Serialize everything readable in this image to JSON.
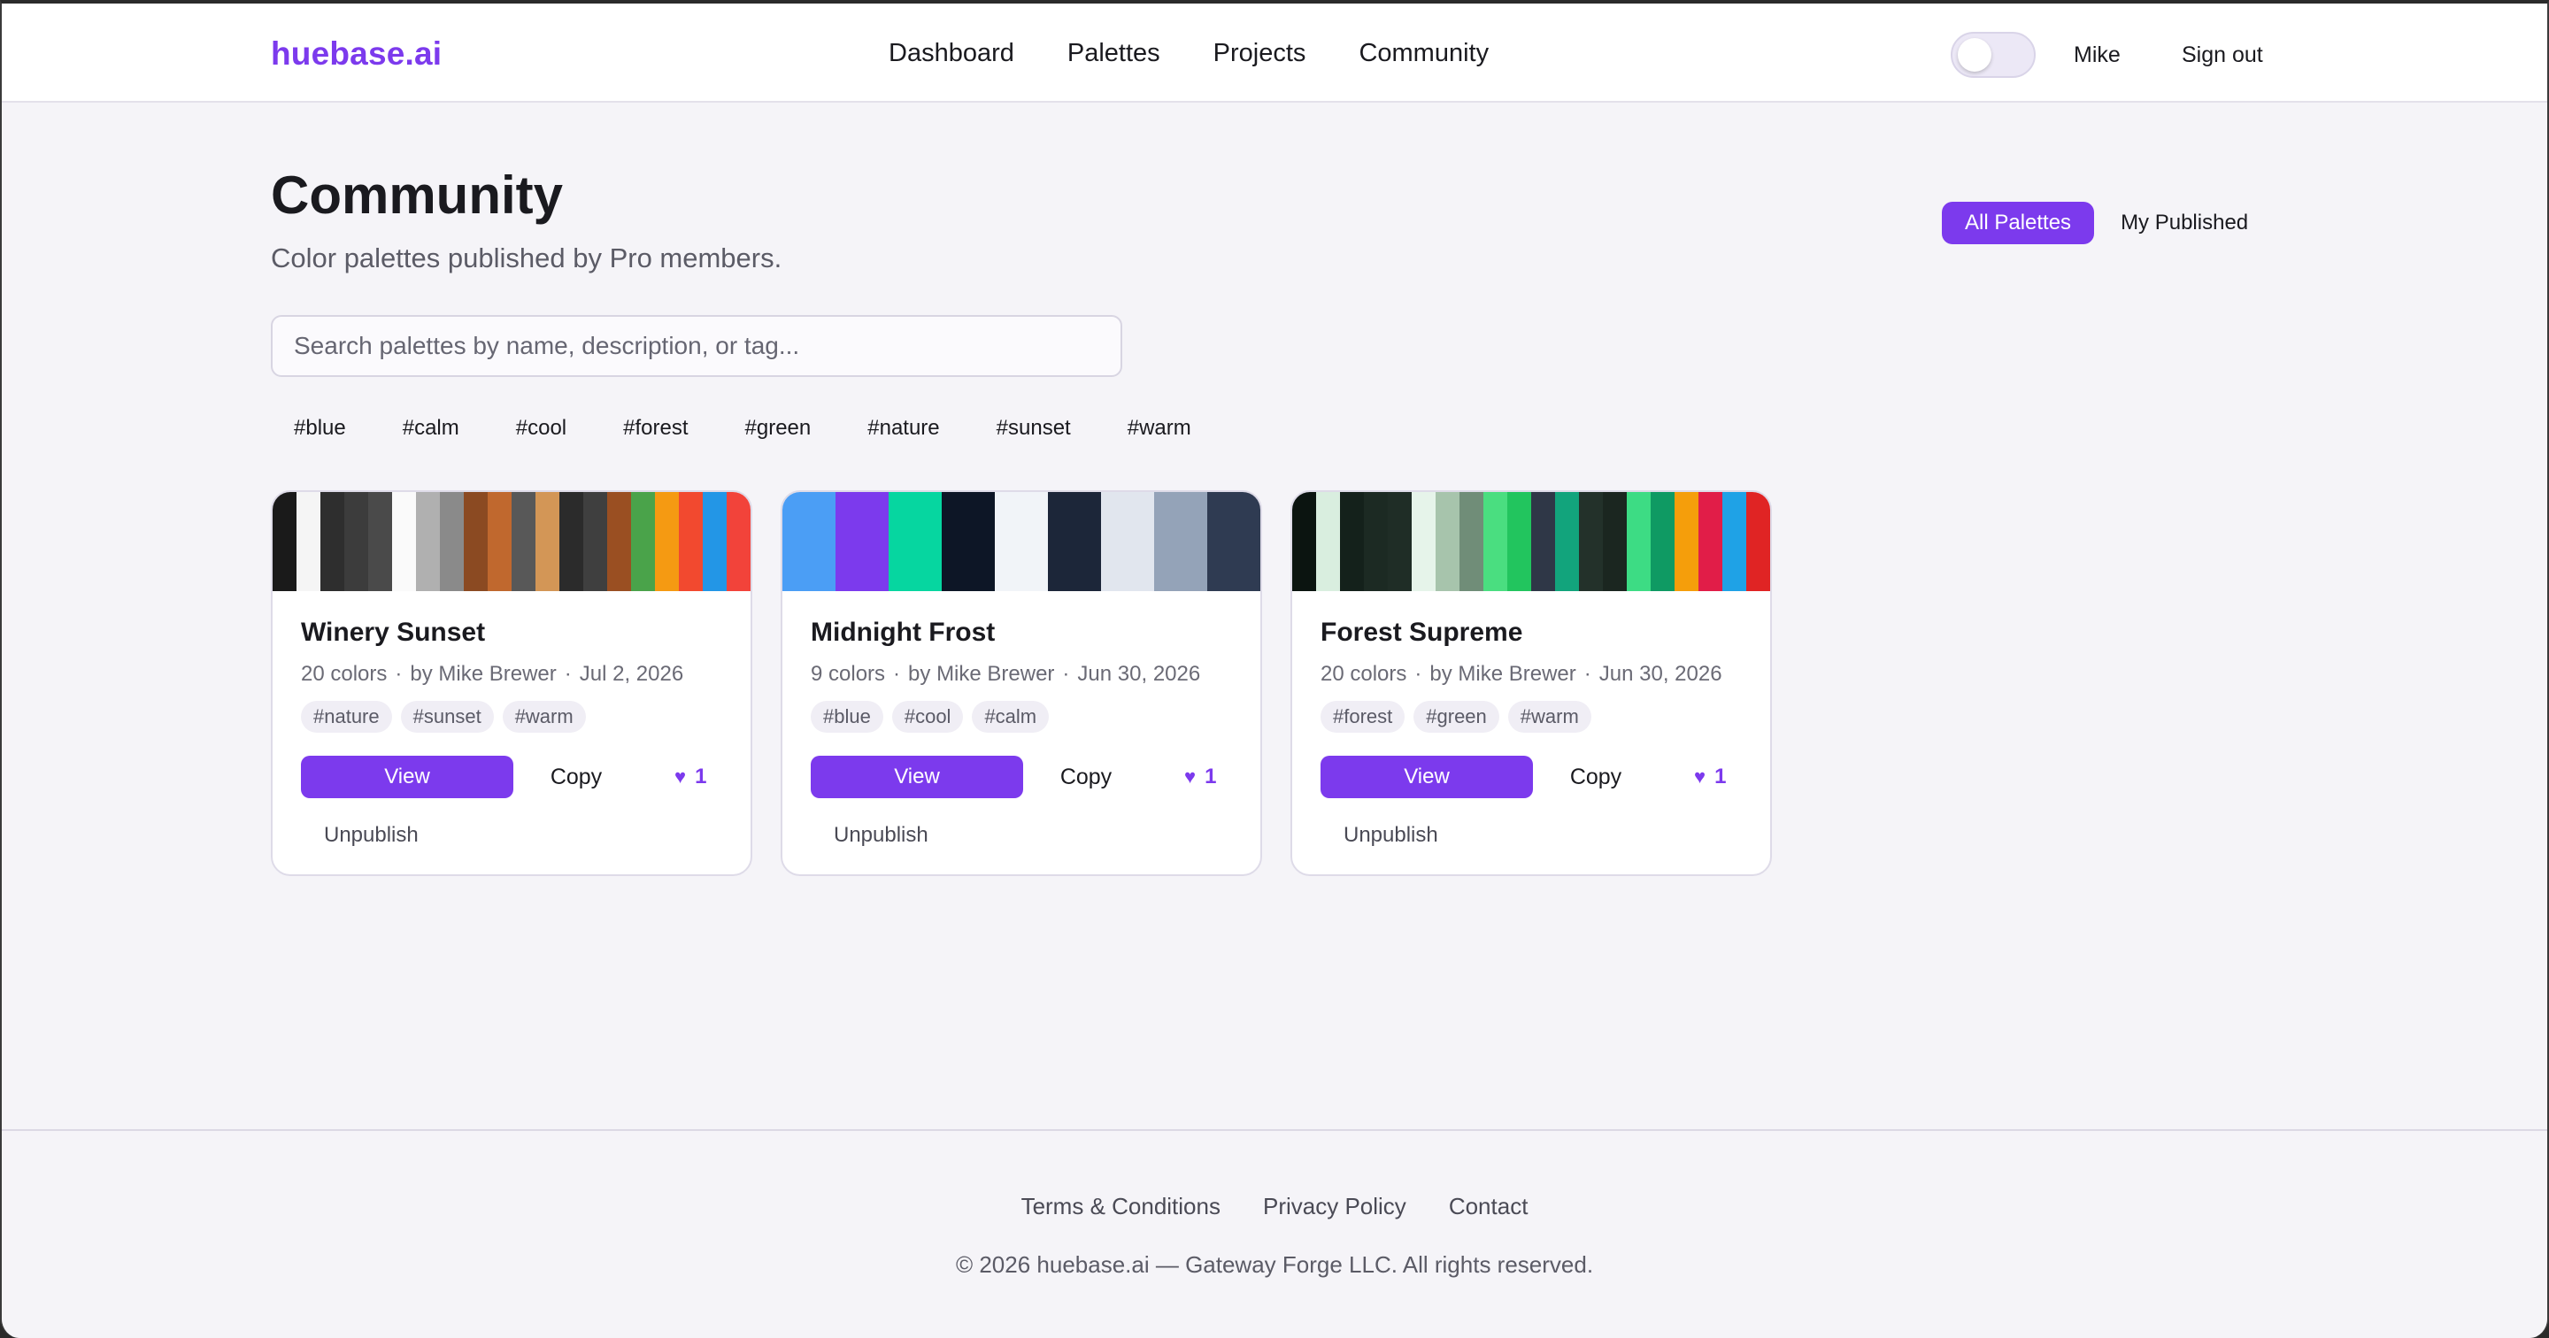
{
  "header": {
    "logo": "huebase.ai",
    "nav": [
      "Dashboard",
      "Palettes",
      "Projects",
      "Community"
    ],
    "theme_toggle": "off",
    "user_name": "Mike",
    "sign_out": "Sign out"
  },
  "page": {
    "title": "Community",
    "subtitle": "Color palettes published by Pro members.",
    "filter_tabs": {
      "active": "All Palettes",
      "other": "My Published"
    }
  },
  "search": {
    "placeholder": "Search palettes by name, description, or tag..."
  },
  "tag_filters": [
    "#blue",
    "#calm",
    "#cool",
    "#forest",
    "#green",
    "#nature",
    "#sunset",
    "#warm"
  ],
  "cards": [
    {
      "name": "Winery Sunset",
      "count": "20 colors",
      "author": "by Mike Brewer",
      "date": "Jul 2, 2026",
      "tags": [
        "#nature",
        "#sunset",
        "#warm"
      ],
      "view": "View",
      "copy": "Copy",
      "likes": "1",
      "unpublish": "Unpublish",
      "swatches": [
        "#1a1a1a",
        "#f5f5f5",
        "#2e2e2e",
        "#3c3c3c",
        "#4a4a4a",
        "#fafafa",
        "#b0b0b0",
        "#8a8a8a",
        "#8b4a22",
        "#c0682e",
        "#585858",
        "#d39656",
        "#2b2b2b",
        "#3f3f3f",
        "#9a4f22",
        "#4aa34a",
        "#f59a12",
        "#f2492f",
        "#2396e6",
        "#f2433a"
      ]
    },
    {
      "name": "Midnight Frost",
      "count": "9 colors",
      "author": "by Mike Brewer",
      "date": "Jun 30, 2026",
      "tags": [
        "#blue",
        "#cool",
        "#calm"
      ],
      "view": "View",
      "copy": "Copy",
      "likes": "1",
      "unpublish": "Unpublish",
      "swatches": [
        "#4b9ef5",
        "#7c3aed",
        "#06d6a0",
        "#0d1626",
        "#f1f4f8",
        "#1c2639",
        "#e1e6ee",
        "#94a3b8",
        "#2f3b52"
      ]
    },
    {
      "name": "Forest Supreme",
      "count": "20 colors",
      "author": "by Mike Brewer",
      "date": "Jun 30, 2026",
      "tags": [
        "#forest",
        "#green",
        "#warm"
      ],
      "view": "View",
      "copy": "Copy",
      "likes": "1",
      "unpublish": "Unpublish",
      "swatches": [
        "#0b1410",
        "#d9eedf",
        "#14211b",
        "#1c2a23",
        "#1f2d26",
        "#e6f4ea",
        "#a7c4ac",
        "#708d78",
        "#4ade80",
        "#22c55e",
        "#2f3747",
        "#12a47c",
        "#23312a",
        "#1b2620",
        "#3ddc84",
        "#0f9a63",
        "#f59e0b",
        "#e11d48",
        "#1fa2e6",
        "#e02424"
      ]
    }
  ],
  "footer": {
    "links": [
      "Terms & Conditions",
      "Privacy Policy",
      "Contact"
    ],
    "copyright": "© 2026 huebase.ai — Gateway Forge LLC. All rights reserved."
  },
  "colors": {
    "accent": "#7c3aed",
    "background": "#f5f4f8",
    "card": "#ffffff"
  }
}
